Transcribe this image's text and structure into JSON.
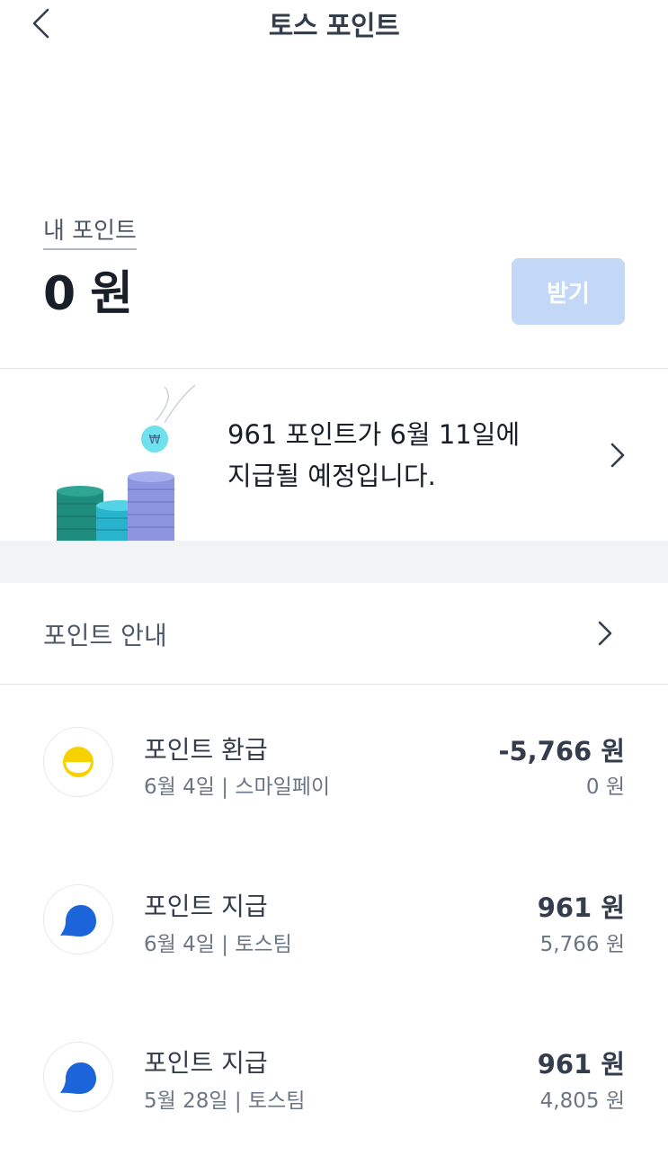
{
  "header": {
    "title": "토스 포인트"
  },
  "summary": {
    "label": "내 포인트",
    "value": "0 원",
    "receive_button": "받기"
  },
  "banner": {
    "line1": "961 포인트가 6월 11일에",
    "line2": "지급될 예정입니다."
  },
  "info_row": {
    "label": "포인트 안내"
  },
  "transactions": [
    {
      "title": "포인트 환급",
      "date": "6월 4일",
      "source": "스마일페이",
      "amount": "-5,766 원",
      "balance": "0 원",
      "icon": "smilepay-icon"
    },
    {
      "title": "포인트 지급",
      "date": "6월 4일",
      "source": "토스팀",
      "amount": "961 원",
      "balance": "5,766 원",
      "icon": "toss-icon"
    },
    {
      "title": "포인트 지급",
      "date": "5월 28일",
      "source": "토스팀",
      "amount": "961 원",
      "balance": "4,805 원",
      "icon": "toss-icon"
    }
  ],
  "colors": {
    "primary_disabled": "#c3d8f6",
    "toss_blue": "#1b64da",
    "smilepay_yellow": "#f7d200"
  }
}
